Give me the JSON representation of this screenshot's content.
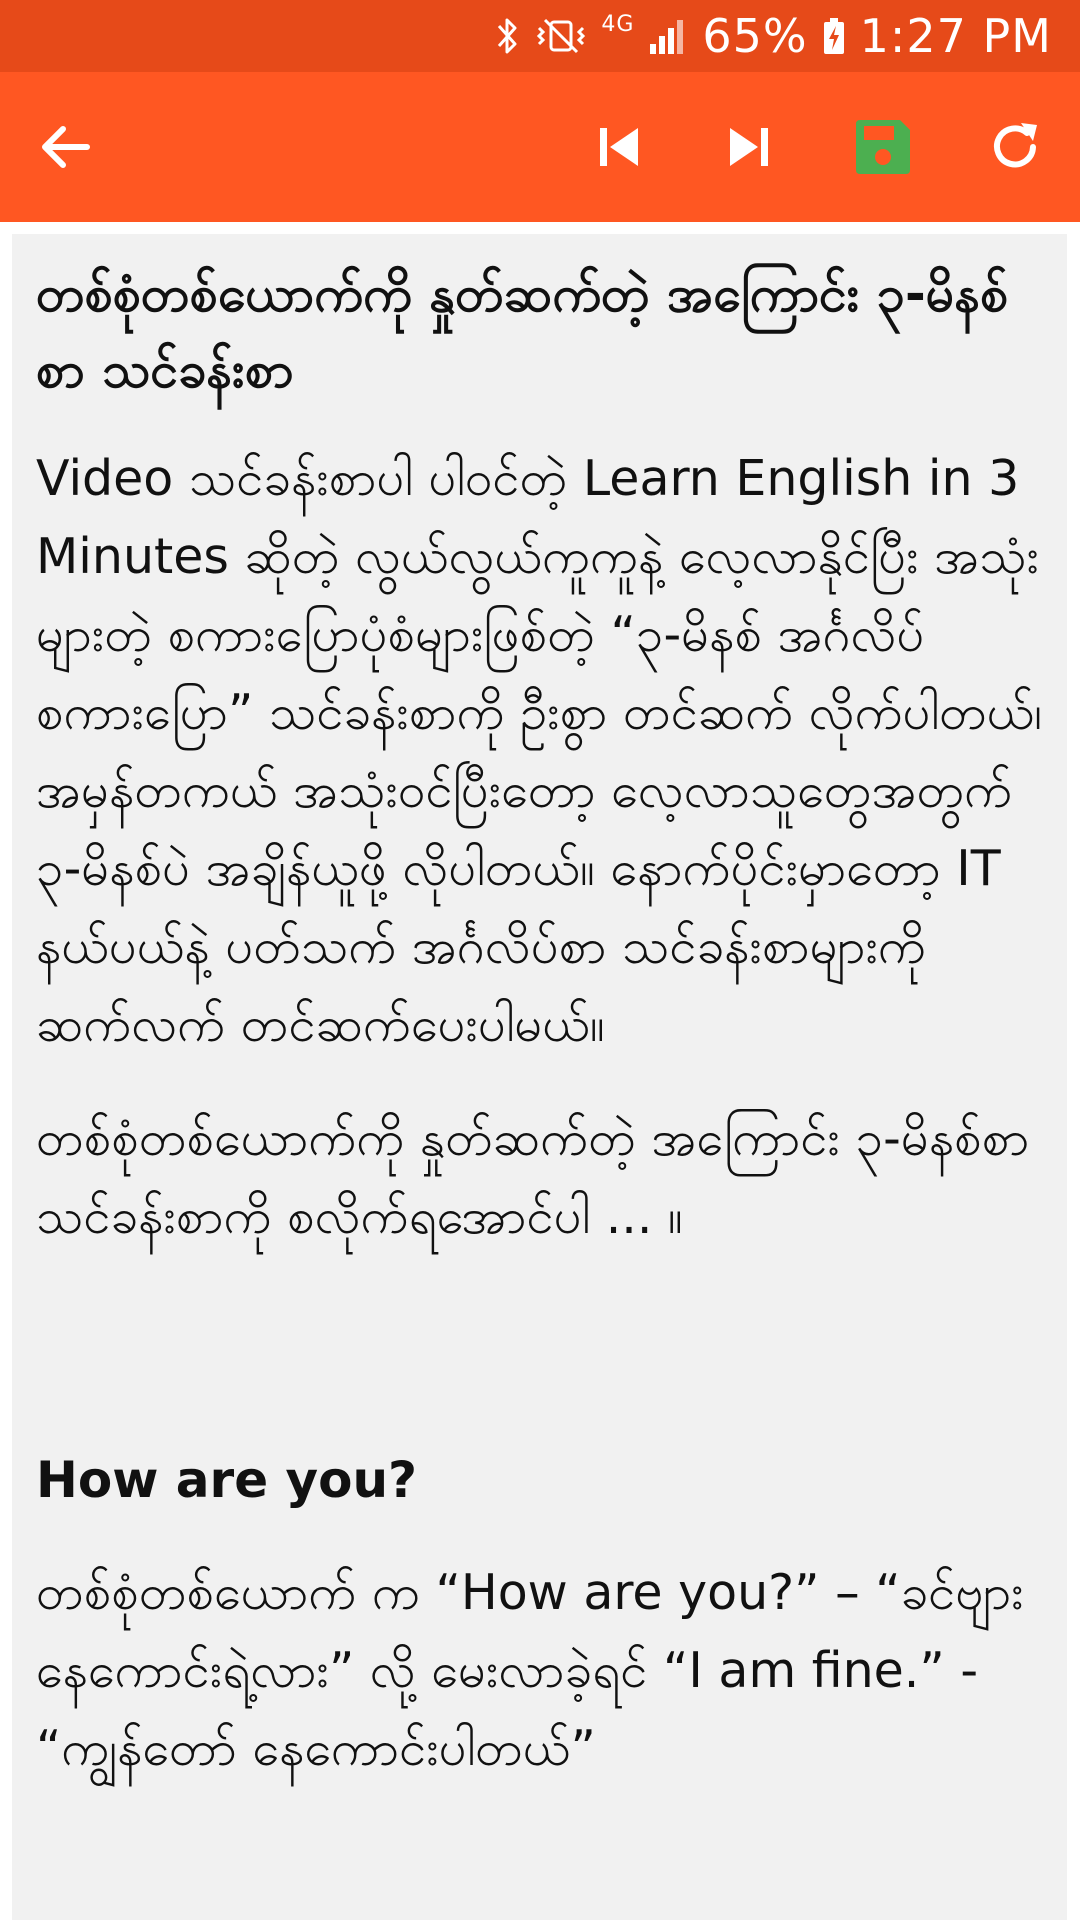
{
  "status_bar": {
    "icons": [
      "bluetooth-icon",
      "vibrate-icon",
      "network-4g-icon",
      "signal-icon",
      "battery-charging-icon"
    ],
    "network": "4G",
    "battery": "65%",
    "time": "1:27 PM",
    "background": "#e64a19"
  },
  "toolbar": {
    "background": "#ff5722",
    "icons": [
      "back-arrow-icon",
      "skip-previous-icon",
      "skip-next-icon",
      "save-icon",
      "refresh-icon"
    ],
    "save_icon_color": "#4caf50"
  },
  "article": {
    "title": "တစ်စုံတစ်ယောက်ကို နှုတ်ဆက်တဲ့ အကြောင်း ၃-မိနစ်စာ သင်ခန်းစာ",
    "intro": "Video သင်ခန်းစာပါ ပါဝင်တဲ့ Learn English in 3 Minutes ဆိုတဲ့ လွယ်လွယ်ကူကူနဲ့ လေ့လာနိုင်ပြီး အသုံးများတဲ့ စကားပြောပုံစံများဖြစ်တဲ့ “၃-မိနစ် အင်္ဂလိပ်စကားပြော” သင်ခန်းစာကို ဦးစွာ တင်ဆက် လိုက်ပါတယ်၊ အမှန်တကယ် အသုံးဝင်ပြီးတော့ လေ့လာသူတွေအတွက် ၃-မိနစ်ပဲ အချိန်ယူဖို့ လိုပါတယ်။ နောက်ပိုင်းမှာတော့ IT နယ်ပယ်နဲ့ ပတ်သက် အင်္ဂလိပ်စာ သင်ခန်းစာများကို ဆက်လက် တင်ဆက်ပေးပါမယ်။",
    "lead_in": "တစ်စုံတစ်ယောက်ကို နှုတ်ဆက်တဲ့ အကြောင်း ၃-မိနစ်စာ သင်ခန်းစာကို စလိုက်ရအောင်ပါ ... ။",
    "subheading": "How are you?",
    "body": "တစ်စုံတစ်ယောက် က “How are you?” – “ခင်ဗျားနေကောင်းရဲ့လား” လို့ မေးလာခဲ့ရင် “I am fine.” - “ကျွန်တော် နေကောင်းပါတယ်”"
  }
}
